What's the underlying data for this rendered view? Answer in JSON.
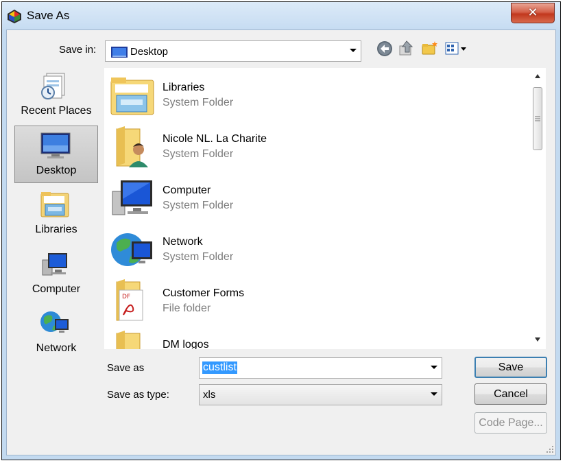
{
  "window": {
    "title": "Save As",
    "close_glyph": "✕"
  },
  "toolbar": {
    "save_in_label": "Save in:",
    "save_in_value": "Desktop",
    "icons": [
      "back-icon",
      "up-folder-icon",
      "new-folder-icon",
      "view-menu-icon"
    ]
  },
  "places": [
    {
      "label": "Recent Places",
      "icon": "recent-places-icon",
      "selected": false
    },
    {
      "label": "Desktop",
      "icon": "desktop-icon",
      "selected": true
    },
    {
      "label": "Libraries",
      "icon": "libraries-icon",
      "selected": false
    },
    {
      "label": "Computer",
      "icon": "computer-icon",
      "selected": false
    },
    {
      "label": "Network",
      "icon": "network-icon",
      "selected": false
    }
  ],
  "files": [
    {
      "name": "Libraries",
      "type": "System Folder",
      "icon": "libraries-folder-icon"
    },
    {
      "name": "Nicole NL. La Charite",
      "type": "System Folder",
      "icon": "user-folder-icon"
    },
    {
      "name": "Computer",
      "type": "System Folder",
      "icon": "computer-icon"
    },
    {
      "name": "Network",
      "type": "System Folder",
      "icon": "network-icon"
    },
    {
      "name": "Customer Forms",
      "type": "File folder",
      "icon": "pdf-folder-icon"
    },
    {
      "name": "DM logos",
      "type": "",
      "icon": "folder-icon"
    }
  ],
  "form": {
    "save_as_label": "Save as",
    "save_as_value": "custlist",
    "save_type_label": "Save as type:",
    "save_type_value": "xls"
  },
  "buttons": {
    "save": "Save",
    "cancel": "Cancel",
    "code_page": "Code Page..."
  },
  "colors": {
    "selection": "#3399ff",
    "title_bar": "#c6dcf2",
    "close_button": "#c1381d"
  }
}
